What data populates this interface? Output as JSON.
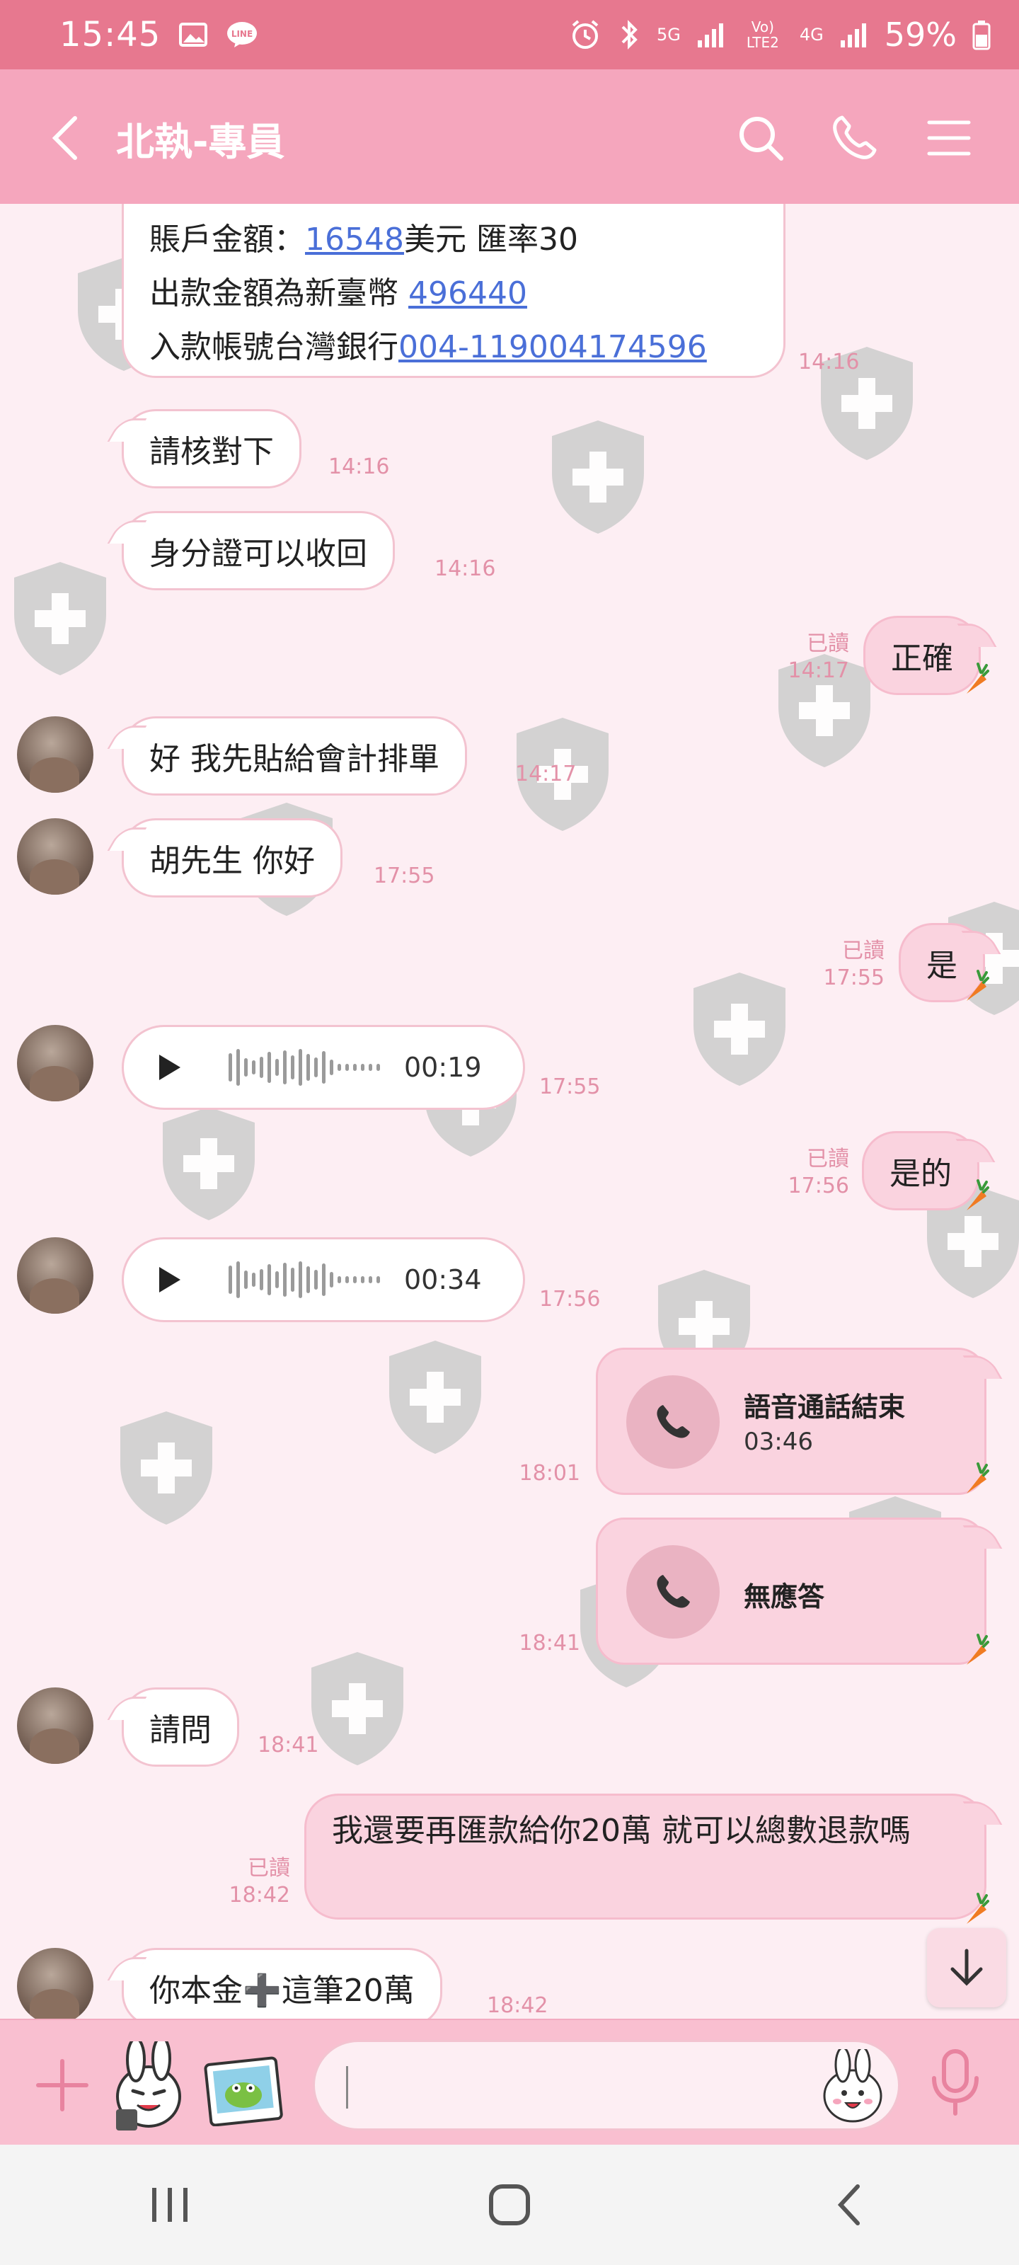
{
  "status_bar": {
    "time": "15:45",
    "network_5g": "5G",
    "volte": "Vo) LTE2",
    "network_4g": "4G",
    "battery": "59%"
  },
  "header": {
    "title": "北執-專員",
    "icons": [
      "back-icon",
      "search-icon",
      "phone-icon",
      "menu-icon"
    ]
  },
  "messages": {
    "m1": {
      "line1_pre": "賬戶金額：",
      "line1_link": "16548",
      "line1_post": "美元 匯率30",
      "line2_pre": "出款金額為新臺幣 ",
      "line2_link": "496440",
      "line3_pre": "入款帳號台灣銀行",
      "line3_link": "004-119004174596",
      "time": "14:16"
    },
    "m2": {
      "text": "請核對下",
      "time": "14:16"
    },
    "m3": {
      "text": "身分證可以收回",
      "time": "14:16"
    },
    "m4": {
      "text": "正確",
      "read": "已讀",
      "time": "14:17"
    },
    "m5": {
      "text": "好 我先貼給會計排單",
      "time": "14:17"
    },
    "m6": {
      "text": "胡先生 你好",
      "time": "17:55"
    },
    "m7": {
      "text": "是",
      "read": "已讀",
      "time": "17:55"
    },
    "m8": {
      "duration": "00:19",
      "time": "17:55"
    },
    "m9": {
      "text": "是的",
      "read": "已讀",
      "time": "17:56"
    },
    "m10": {
      "duration": "00:34",
      "time": "17:56"
    },
    "m11": {
      "title": "語音通話結束",
      "duration": "03:46",
      "time": "18:01"
    },
    "m12": {
      "title": "無應答",
      "time": "18:41"
    },
    "m13": {
      "text": "請問",
      "time": "18:41"
    },
    "m14": {
      "text": "我還要再匯款給你20萬 就可以總數退款嗎",
      "read": "已讀",
      "time": "18:42"
    },
    "m15": {
      "text": "你本金➕這筆20萬",
      "time": "18:42"
    }
  },
  "colors": {
    "header": "#f5a6bd",
    "status_bar": "#e7788f",
    "chat_bg": "#fdeef3",
    "outgoing_bubble": "#fad3df",
    "timestamp": "#e391a8",
    "link": "#4a6fd8"
  }
}
